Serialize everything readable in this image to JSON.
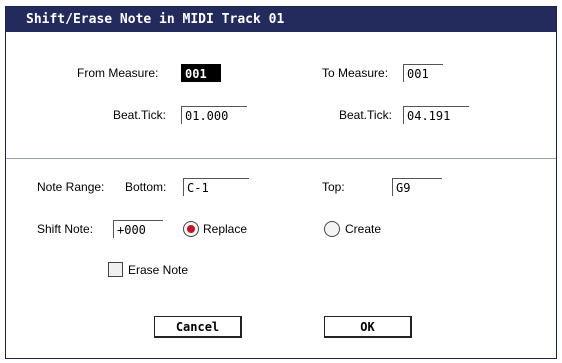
{
  "dialog": {
    "title": "Shift/Erase Note in MIDI Track 01"
  },
  "range": {
    "from_measure_label": "From Measure:",
    "from_measure_value": "001",
    "to_measure_label": "To Measure:",
    "to_measure_value": "001",
    "from_beat_label": "Beat.Tick:",
    "from_beat_value": "01.000",
    "to_beat_label": "Beat.Tick:",
    "to_beat_value": "04.191"
  },
  "note": {
    "range_label": "Note Range:",
    "bottom_label": "Bottom:",
    "bottom_value": "C-1",
    "top_label": "Top:",
    "top_value": "G9",
    "shift_label": "Shift Note:",
    "shift_value": "+000",
    "replace_label": "Replace",
    "create_label": "Create",
    "mode_selected": "Replace",
    "erase_label": "Erase Note",
    "erase_checked": false
  },
  "buttons": {
    "cancel": "Cancel",
    "ok": "OK"
  },
  "colors": {
    "title_bar": "#232a5c",
    "radio_selected": "#c0152a"
  }
}
